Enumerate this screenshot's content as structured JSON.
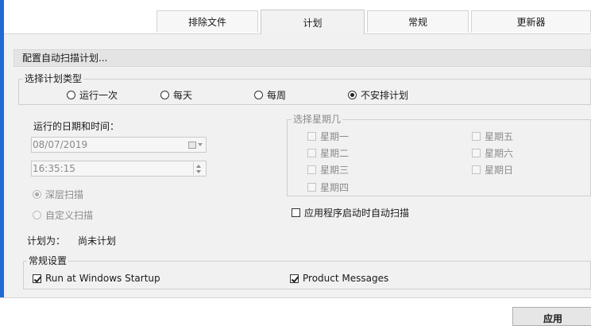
{
  "tabs": [
    {
      "label": "排除文件",
      "active": false
    },
    {
      "label": "计划",
      "active": true
    },
    {
      "label": "常规",
      "active": false
    },
    {
      "label": "更新器",
      "active": false
    }
  ],
  "section": {
    "title": "配置自动扫描计划..."
  },
  "schedule_type": {
    "legend": "选择计划类型",
    "options": [
      {
        "label": "运行一次",
        "selected": false
      },
      {
        "label": "每天",
        "selected": false
      },
      {
        "label": "每周",
        "selected": false
      },
      {
        "label": "不安排计划",
        "selected": true
      }
    ]
  },
  "run_datetime": {
    "label": "运行的日期和时间：",
    "date_value": "08/07/2019",
    "time_value": "16:35:15"
  },
  "scan_type": {
    "options": [
      {
        "label": "深层扫描",
        "selected": true
      },
      {
        "label": "自定义扫描",
        "selected": false
      }
    ]
  },
  "schedule_status": {
    "label": "计划为：",
    "value": "尚未计划"
  },
  "weekdays": {
    "legend": "选择星期几",
    "days": [
      {
        "label": "星期一",
        "checked": false
      },
      {
        "label": "星期二",
        "checked": false
      },
      {
        "label": "星期三",
        "checked": false
      },
      {
        "label": "星期四",
        "checked": false
      },
      {
        "label": "星期五",
        "checked": false
      },
      {
        "label": "星期六",
        "checked": false
      },
      {
        "label": "星期日",
        "checked": false
      }
    ]
  },
  "startup_scan": {
    "label": "应用程序启动时自动扫描",
    "checked": false
  },
  "general": {
    "legend": "常规设置",
    "run_at_startup": {
      "label": "Run at Windows Startup",
      "checked": true
    },
    "product_messages": {
      "label": "Product Messages",
      "checked": true
    }
  },
  "footer": {
    "apply_label": "应用"
  },
  "colors": {
    "accent_edge": "#1e6bd6",
    "panel_bg": "#f1f1f1"
  }
}
